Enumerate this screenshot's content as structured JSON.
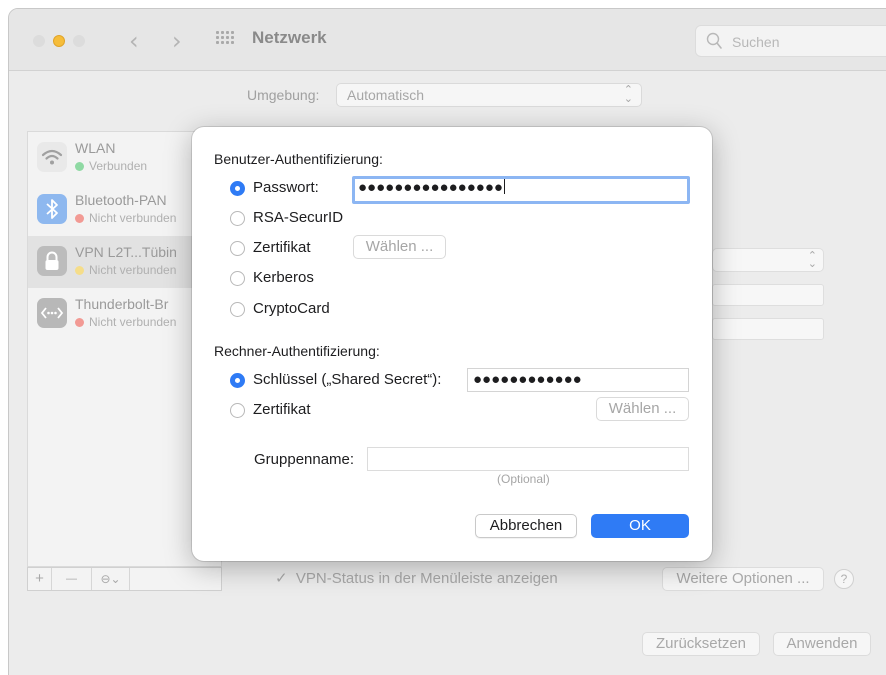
{
  "window": {
    "title": "Netzwerk",
    "search_placeholder": "Suchen",
    "nav_back": "‹",
    "nav_forward": "›"
  },
  "background": {
    "umgebung_label": "Umgebung:",
    "umgebung_value": "Automatisch",
    "services": [
      {
        "name": "WLAN",
        "status": "Verbunden",
        "status_color": "#34c759",
        "icon": "wifi-icon"
      },
      {
        "name": "Bluetooth-PAN",
        "status": "Nicht verbunden",
        "status_color": "#ff3b30",
        "icon": "bluetooth-icon"
      },
      {
        "name": "VPN L2T...Tübin",
        "status": "Nicht verbunden",
        "status_color": "#ffcc00",
        "icon": "lock-icon"
      },
      {
        "name": "Thunderbolt-Br",
        "status": "Nicht verbunden",
        "status_color": "#ff3b30",
        "icon": "thunderbolt-bridge-icon"
      }
    ],
    "toolbar": {
      "add": "+",
      "remove": "—",
      "action": "⊖⌄"
    },
    "vpn_status_label": "VPN-Status in der Menüleiste anzeigen",
    "weitere_optionen": "Weitere Optionen ...",
    "help": "?",
    "zuruecksetzen": "Zurücksetzen",
    "anwenden": "Anwenden"
  },
  "dialog": {
    "user_auth_title": "Benutzer-Authentifizierung:",
    "user_options": [
      {
        "label": "Passwort:",
        "selected": true
      },
      {
        "label": "RSA-SecurID",
        "selected": false
      },
      {
        "label": "Zertifikat",
        "selected": false
      },
      {
        "label": "Kerberos",
        "selected": false
      },
      {
        "label": "CryptoCard",
        "selected": false
      }
    ],
    "password_value": "●●●●●●●●●●●●●●●●",
    "waehlen_user": "Wählen ...",
    "machine_auth_title": "Rechner-Authentifizierung:",
    "machine_options": [
      {
        "label": "Schlüssel („Shared Secret“):",
        "selected": true
      },
      {
        "label": "Zertifikat",
        "selected": false
      }
    ],
    "shared_secret_value": "●●●●●●●●●●●●",
    "waehlen_machine": "Wählen ...",
    "gruppenname_label": "Gruppenname:",
    "gruppenname_value": "",
    "optional_hint": "(Optional)",
    "cancel": "Abbrechen",
    "ok": "OK"
  },
  "colors": {
    "accent": "#2f7bf5",
    "focus_ring": "#8cb6f3"
  }
}
